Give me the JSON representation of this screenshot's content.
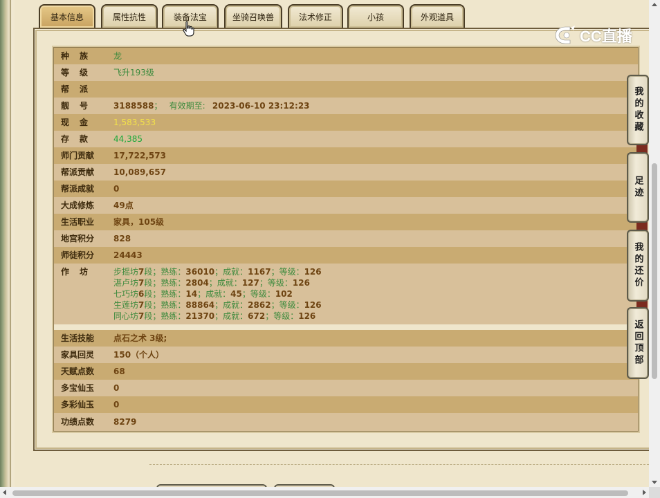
{
  "tabs": [
    {
      "label": "基本信息",
      "active": true
    },
    {
      "label": "属性抗性",
      "active": false
    },
    {
      "label": "装备法宝",
      "active": false
    },
    {
      "label": "坐骑召唤兽",
      "active": false
    },
    {
      "label": "法术修正",
      "active": false
    },
    {
      "label": "小孩",
      "active": false
    },
    {
      "label": "外观道具",
      "active": false
    }
  ],
  "watermark": {
    "text": "CC直播"
  },
  "info": {
    "race": {
      "label": "种族",
      "value": "龙"
    },
    "level": {
      "label": "等级",
      "value": "飞升193级"
    },
    "faction": {
      "label": "帮派",
      "value": ""
    },
    "pretty_id": {
      "label": "靓号",
      "value": "3188588",
      "sep": "；",
      "expiry_label": "有效期至:",
      "expiry": "2023-06-10 23:12:23"
    },
    "cash": {
      "label": "现金",
      "value": "1,583,533"
    },
    "deposit": {
      "label": "存款",
      "value": "44,385"
    },
    "school_contrib": {
      "label": "师门贡献",
      "value": "17,722,573"
    },
    "faction_contrib": {
      "label": "帮派贡献",
      "value": "10,089,657"
    },
    "faction_achieve": {
      "label": "帮派成就",
      "value": "0"
    },
    "cultivation": {
      "label": "大成修炼",
      "value": "49点"
    },
    "life_job": {
      "label": "生活职业",
      "value": "家具，105级"
    },
    "palace_points": {
      "label": "地宫积分",
      "value": "828"
    },
    "mentor_points": {
      "label": "师徒积分",
      "value": "24443"
    },
    "workshop": {
      "label": "作坊",
      "lines": [
        {
          "name": "步摇坊",
          "seg": "7",
          "seg_unit": "段；熟练：",
          "skill": "36010",
          "ach_label": "；成就：",
          "ach": "1167",
          "lvl_label": "；等级：",
          "lvl": "126"
        },
        {
          "name": "湛卢坊",
          "seg": "7",
          "seg_unit": "段；熟练：",
          "skill": "2804",
          "ach_label": "；成就：",
          "ach": "127",
          "lvl_label": "；等级：",
          "lvl": "126"
        },
        {
          "name": "七巧坊",
          "seg": "6",
          "seg_unit": "段；熟练：",
          "skill": "14",
          "ach_label": "；成就：",
          "ach": "45",
          "lvl_label": "；等级：",
          "lvl": "102"
        },
        {
          "name": "生莲坊",
          "seg": "7",
          "seg_unit": "段；熟练：",
          "skill": "88864",
          "ach_label": "；成就：",
          "ach": "2862",
          "lvl_label": "；等级：",
          "lvl": "126"
        },
        {
          "name": "同心坊",
          "seg": "7",
          "seg_unit": "段；熟练：",
          "skill": "21370",
          "ach_label": "；成就：",
          "ach": "672",
          "lvl_label": "；等级：",
          "lvl": "126"
        }
      ]
    },
    "life_skill": {
      "label": "生活技能",
      "value": "点石之术 3级;"
    },
    "furniture_spirit": {
      "label": "家具回灵",
      "value": "150（个人）"
    },
    "talent_points": {
      "label": "天赋点数",
      "value": "68"
    },
    "duobao_jade": {
      "label": "多宝仙玉",
      "value": "0"
    },
    "duocai_jade": {
      "label": "多彩仙玉",
      "value": "0"
    },
    "merit_points": {
      "label": "功绩点数",
      "value": "8279"
    }
  },
  "side_buttons": {
    "favorites": "我的收藏",
    "footprints": "足迹",
    "my_offers": "我的还价",
    "back_to_top": "返回顶部"
  },
  "colors": {
    "row_dark": "#c9ab72",
    "row_light": "#d8c09a",
    "value_brown": "#6e4412",
    "value_green": "#3d8a3d",
    "cash_yellow": "#f2e14a",
    "deposit_green": "#1ba83a"
  }
}
